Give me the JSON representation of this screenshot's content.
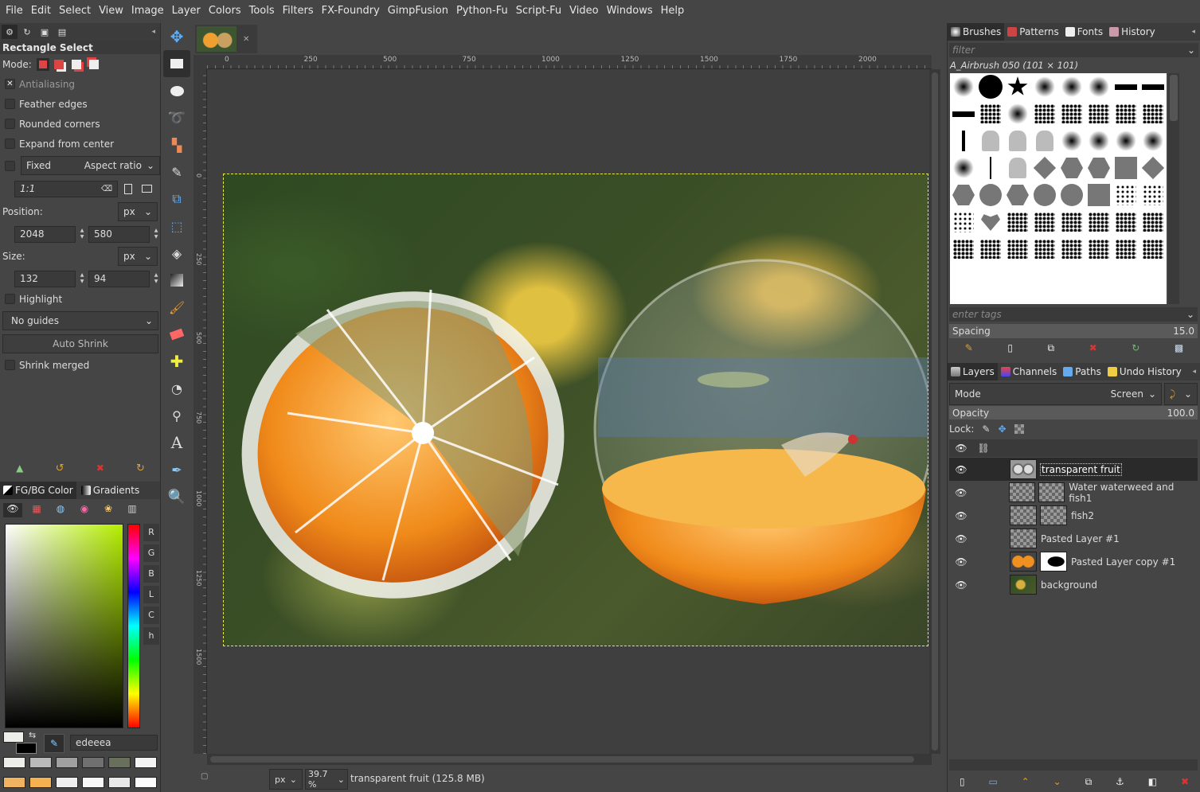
{
  "menu": [
    "File",
    "Edit",
    "Select",
    "View",
    "Image",
    "Layer",
    "Colors",
    "Tools",
    "Filters",
    "FX-Foundry",
    "GimpFusion",
    "Python-Fu",
    "Script-Fu",
    "Video",
    "Windows",
    "Help"
  ],
  "tool_options": {
    "title": "Rectangle Select",
    "mode_label": "Mode:",
    "antialiasing": "Antialiasing",
    "feather": "Feather edges",
    "rounded": "Rounded corners",
    "expand": "Expand from center",
    "fixed": "Fixed",
    "fixed_mode": "Aspect ratio",
    "ratio": "1:1",
    "position_label": "Position:",
    "position_unit": "px",
    "pos_x": "2048",
    "pos_y": "580",
    "size_label": "Size:",
    "size_unit": "px",
    "size_w": "132",
    "size_h": "94",
    "highlight": "Highlight",
    "guides": "No guides",
    "auto_shrink": "Auto Shrink",
    "shrink_merged": "Shrink merged"
  },
  "fgbg": {
    "tab1": "FG/BG Color",
    "tab2": "Gradients",
    "channels": [
      "R",
      "G",
      "B",
      "L",
      "C",
      "h"
    ],
    "hex": "edeeea"
  },
  "ruler_marks": [
    "0",
    "250",
    "500",
    "750",
    "1000",
    "1250",
    "1500",
    "1750",
    "2000"
  ],
  "vruler_marks": [
    "0",
    "250",
    "500",
    "750",
    "1000",
    "1250",
    "1500"
  ],
  "status": {
    "unit": "px",
    "zoom": "39.7 %",
    "text": "transparent fruit (125.8 MB)"
  },
  "brushes": {
    "tabs": [
      "Brushes",
      "Patterns",
      "Fonts",
      "History"
    ],
    "filter_placeholder": "filter",
    "brush_name": "A_Airbrush 050 (101 × 101)",
    "tags_placeholder": "enter tags",
    "spacing_label": "Spacing",
    "spacing_value": "15.0"
  },
  "layers_panel": {
    "tabs": [
      "Layers",
      "Channels",
      "Paths",
      "Undo History"
    ],
    "mode_label": "Mode",
    "mode_value": "Screen",
    "opacity_label": "Opacity",
    "opacity_value": "100.0",
    "lock_label": "Lock:",
    "layers": [
      {
        "name": "transparent fruit"
      },
      {
        "name": "Water waterweed and fish1"
      },
      {
        "name": "fish2"
      },
      {
        "name": "Pasted Layer #1"
      },
      {
        "name": "Pasted Layer copy #1"
      },
      {
        "name": "background"
      }
    ]
  }
}
